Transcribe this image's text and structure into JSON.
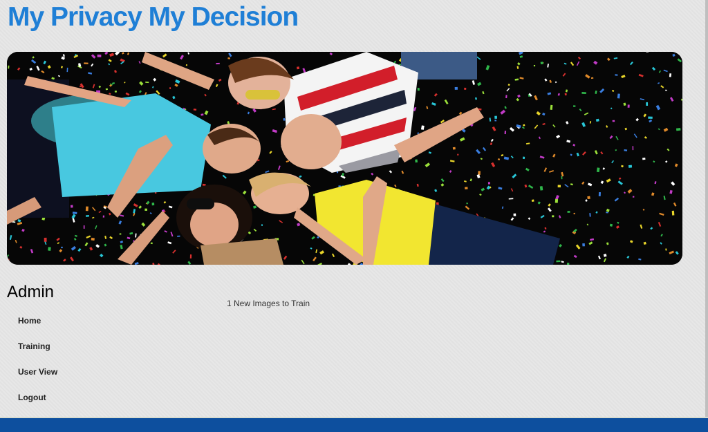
{
  "site": {
    "title": "My Privacy My Decision"
  },
  "banner": {
    "image": "group-of-friends-lying-in-confetti-photo"
  },
  "sidebar": {
    "heading": "Admin",
    "items": [
      {
        "label": "Home"
      },
      {
        "label": "Training"
      },
      {
        "label": "User View"
      },
      {
        "label": "Logout"
      }
    ]
  },
  "main": {
    "notice": "1 New Images to Train"
  },
  "colors": {
    "title": "#1f7fd6",
    "footer": "#0d4f9e",
    "background": "#e6e6e6"
  }
}
